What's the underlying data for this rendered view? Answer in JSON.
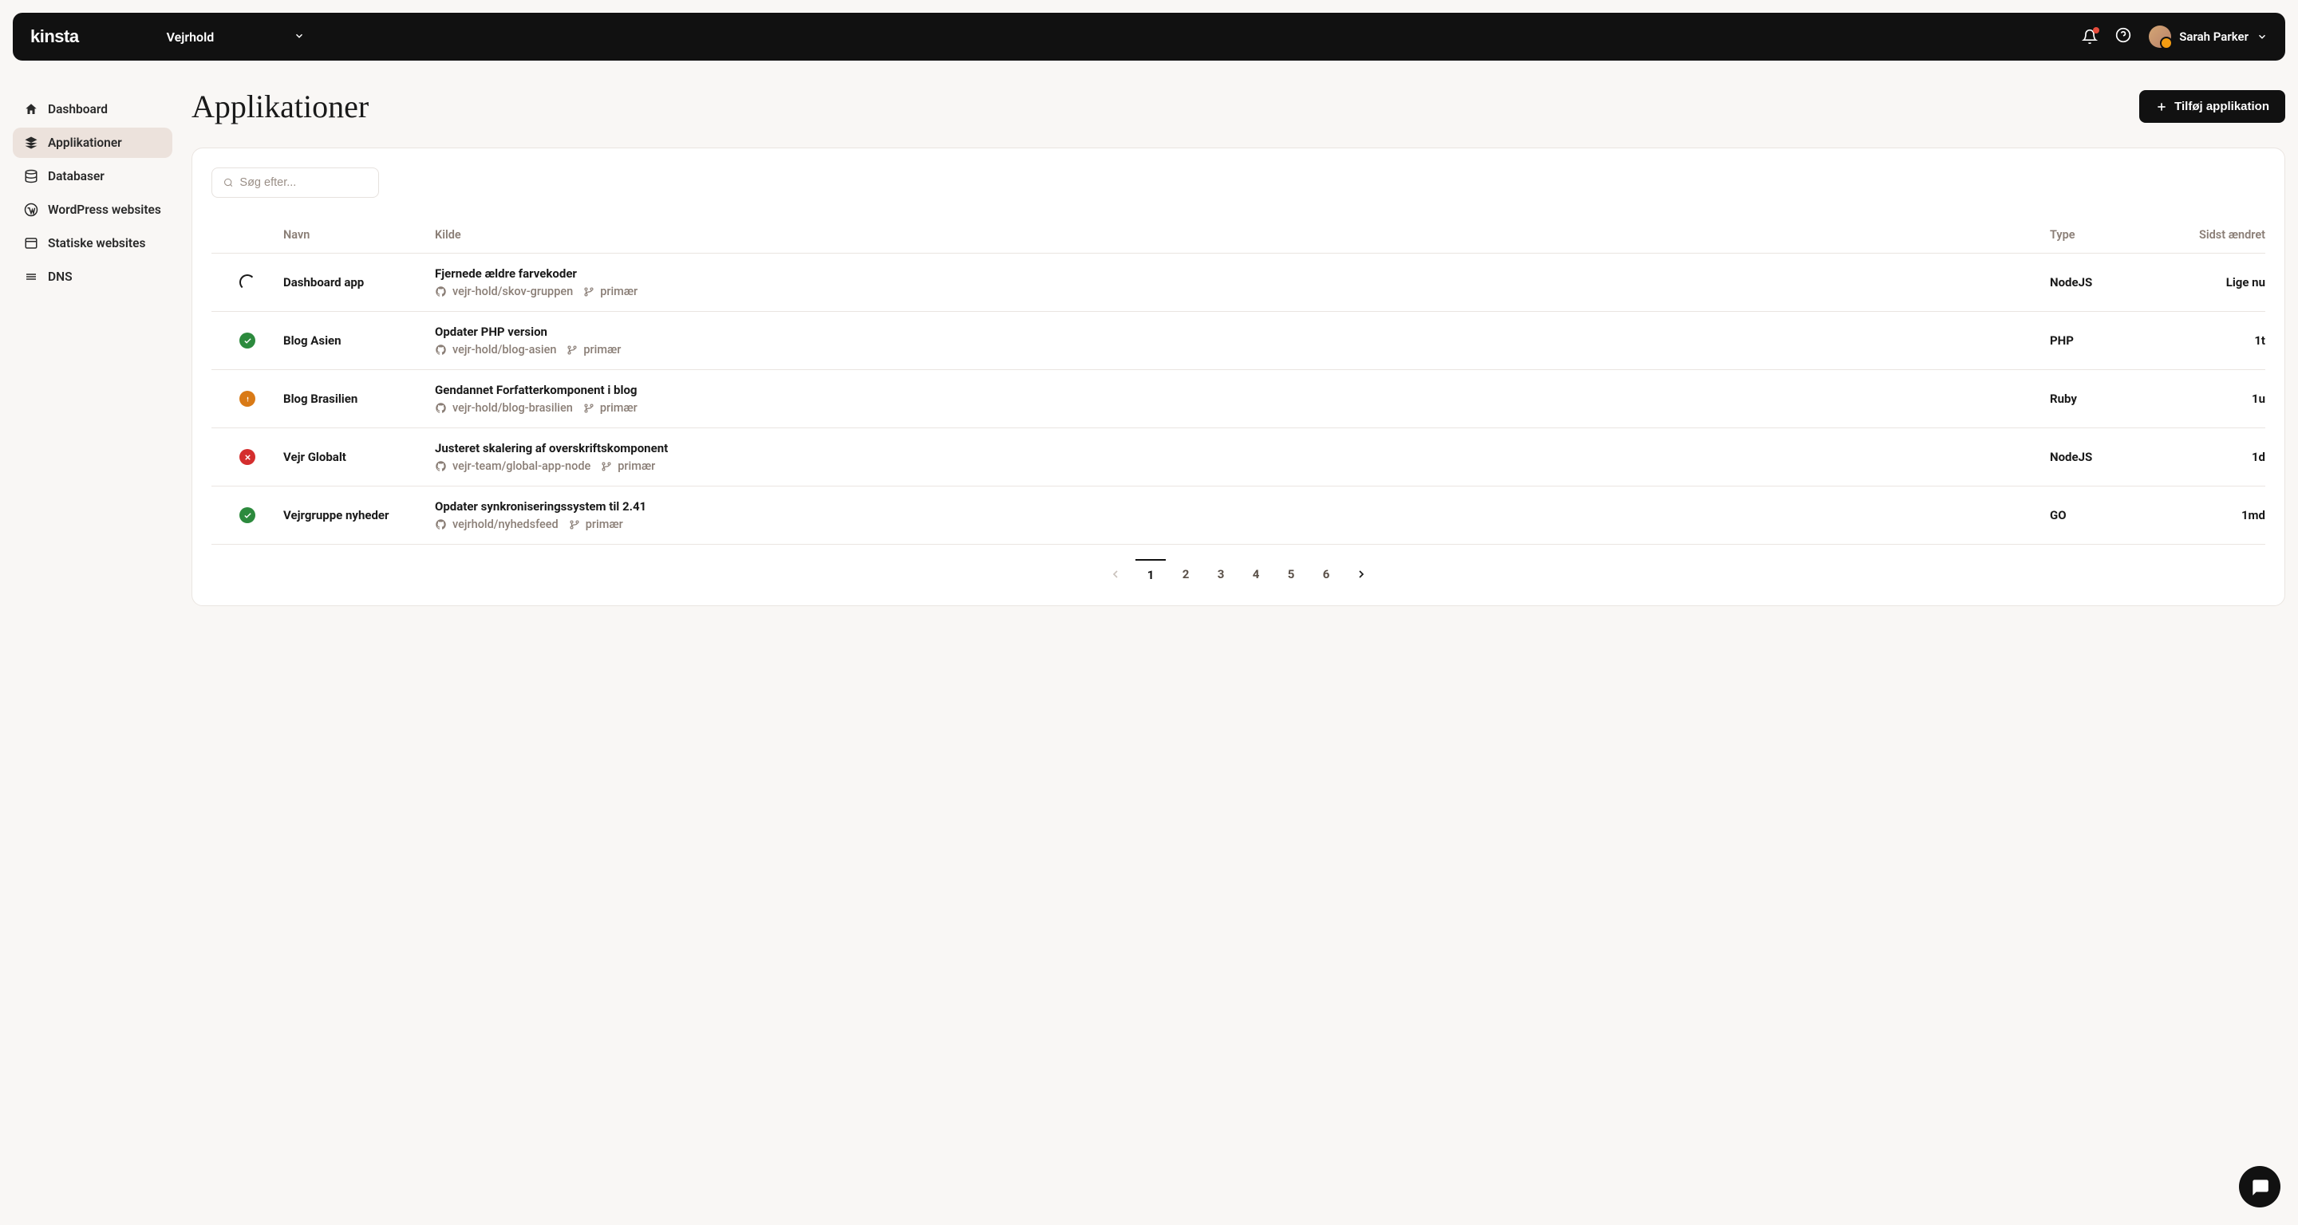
{
  "topbar": {
    "logo": "kinsta",
    "company": "Vejrhold",
    "user_name": "Sarah Parker"
  },
  "sidebar": {
    "items": [
      {
        "label": "Dashboard"
      },
      {
        "label": "Applikationer"
      },
      {
        "label": "Databaser"
      },
      {
        "label": "WordPress websites"
      },
      {
        "label": "Statiske websites"
      },
      {
        "label": "DNS"
      }
    ]
  },
  "page": {
    "title": "Applikationer",
    "add_button": "Tilføj applikation",
    "search_placeholder": "Søg efter..."
  },
  "table": {
    "headers": {
      "name": "Navn",
      "source": "Kilde",
      "type": "Type",
      "modified": "Sidst ændret"
    },
    "rows": [
      {
        "status": "loading",
        "name": "Dashboard app",
        "commit": "Fjernede ældre farvekoder",
        "repo": "vejr-hold/skov-gruppen",
        "branch": "primær",
        "type": "NodeJS",
        "modified": "Lige nu"
      },
      {
        "status": "success",
        "name": "Blog Asien",
        "commit": "Opdater PHP version",
        "repo": "vejr-hold/blog-asien",
        "branch": "primær",
        "type": "PHP",
        "modified": "1t"
      },
      {
        "status": "warning",
        "name": "Blog Brasilien",
        "commit": "Gendannet Forfatterkomponent i blog",
        "repo": "vejr-hold/blog-brasilien",
        "branch": "primær",
        "type": "Ruby",
        "modified": "1u"
      },
      {
        "status": "error",
        "name": "Vejr Globalt",
        "commit": "Justeret skalering af overskriftskomponent",
        "repo": "vejr-team/global-app-node",
        "branch": "primær",
        "type": "NodeJS",
        "modified": "1d"
      },
      {
        "status": "success",
        "name": "Vejrgruppe nyheder",
        "commit": "Opdater synkroniseringssystem til 2.41",
        "repo": "vejrhold/nyhedsfeed",
        "branch": "primær",
        "type": "GO",
        "modified": "1md"
      }
    ]
  },
  "pagination": {
    "pages": [
      "1",
      "2",
      "3",
      "4",
      "5",
      "6"
    ],
    "current": "1"
  }
}
